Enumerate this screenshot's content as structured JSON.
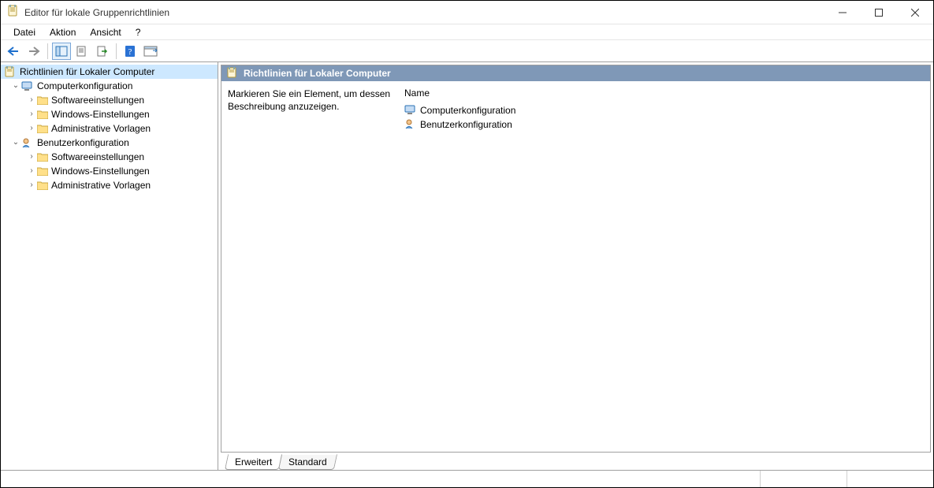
{
  "title": "Editor für lokale Gruppenrichtlinien",
  "menu": {
    "file": "Datei",
    "action": "Aktion",
    "view": "Ansicht",
    "help": "?"
  },
  "tree": {
    "root": "Richtlinien für Lokaler Computer",
    "computer": "Computerkonfiguration",
    "user": "Benutzerkonfiguration",
    "sw": "Softwareeinstellungen",
    "win": "Windows-Einstellungen",
    "adm": "Administrative Vorlagen"
  },
  "details": {
    "heading": "Richtlinien für Lokaler Computer",
    "description": "Markieren Sie ein Element, um dessen Beschreibung anzuzeigen.",
    "col_name": "Name",
    "items": {
      "computer": "Computerkonfiguration",
      "user": "Benutzerkonfiguration"
    }
  },
  "tabs": {
    "extended": "Erweitert",
    "standard": "Standard"
  }
}
